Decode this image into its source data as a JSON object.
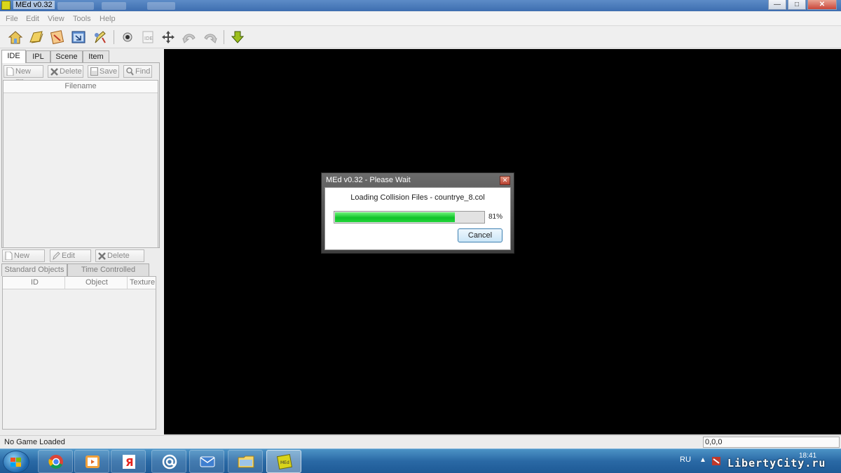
{
  "window": {
    "title": "MEd v0.32"
  },
  "menu": {
    "items": [
      "File",
      "Edit",
      "View",
      "Tools",
      "Help"
    ]
  },
  "toolbar": {
    "icons": [
      "home-icon",
      "open-folder-icon",
      "map-icon",
      "select-window-icon",
      "tool-pencil-icon",
      "record-icon",
      "ide-icon",
      "move-icon",
      "undo-icon",
      "redo-icon",
      "download-arrow-icon"
    ]
  },
  "left_panel": {
    "tabs": [
      {
        "label": "IDE",
        "active": true
      },
      {
        "label": "IPL",
        "active": false
      },
      {
        "label": "Scene",
        "active": false
      },
      {
        "label": "Item",
        "active": false
      }
    ],
    "file_buttons": {
      "new": "New File",
      "delete": "Delete",
      "save": "Save",
      "find": "Find"
    },
    "file_list": {
      "header": "Filename"
    },
    "item_buttons": {
      "new": "New Item",
      "edit": "Edit Item",
      "delete": "Delete Item"
    },
    "object_tabs": [
      {
        "label": "Standard Objects",
        "active": true
      },
      {
        "label": "Time Controlled Objects",
        "active": false
      }
    ],
    "object_list": {
      "columns": [
        "ID",
        "Object",
        "Texture"
      ]
    }
  },
  "dialog": {
    "title": "MEd v0.32 - Please Wait",
    "message": "Loading Collision Files - countrye_8.col",
    "progress": 0.81,
    "progress_label": "81%",
    "cancel_label": "Cancel"
  },
  "status": {
    "text": "No Game Loaded",
    "coords": "0,0,0"
  },
  "taskbar": {
    "apps": [
      "chrome-icon",
      "media-player-icon",
      "yandex-icon",
      "mail-at-icon",
      "mail-envelope-icon",
      "explorer-folder-icon",
      "med-app-icon"
    ],
    "active_app": 6,
    "language": "RU",
    "clock": "18:41",
    "watermark": "LibertyCity.ru"
  },
  "colors": {
    "progress_green": "#10c32a",
    "viewport": "#000000",
    "accent": "#3c7fb1"
  }
}
